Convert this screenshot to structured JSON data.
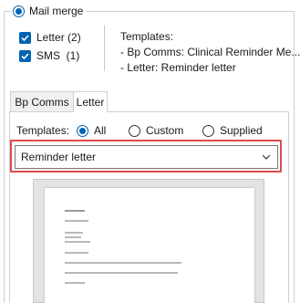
{
  "mail_merge": {
    "label": "Mail merge",
    "selected": true,
    "letter_checkbox": {
      "label": "Letter (2)",
      "checked": true
    },
    "sms_checkbox": {
      "label": "SMS  (1)",
      "checked": true
    },
    "templates_heading": "Templates:",
    "templates_list": [
      "- Bp Comms: Clinical Reminder Me...",
      "- Letter: Reminder letter"
    ]
  },
  "tabs": [
    {
      "label": "Bp Comms",
      "active": false
    },
    {
      "label": "Letter",
      "active": true
    }
  ],
  "filter": {
    "label": "Templates:",
    "options": [
      {
        "label": "All",
        "selected": true
      },
      {
        "label": "Custom",
        "selected": false
      },
      {
        "label": "Supplied",
        "selected": false
      }
    ]
  },
  "template_select": {
    "value": "Reminder letter",
    "icon": "chevron-down-icon"
  },
  "colors": {
    "accent": "#0063b1",
    "highlight_border": "#dd4b4b"
  }
}
